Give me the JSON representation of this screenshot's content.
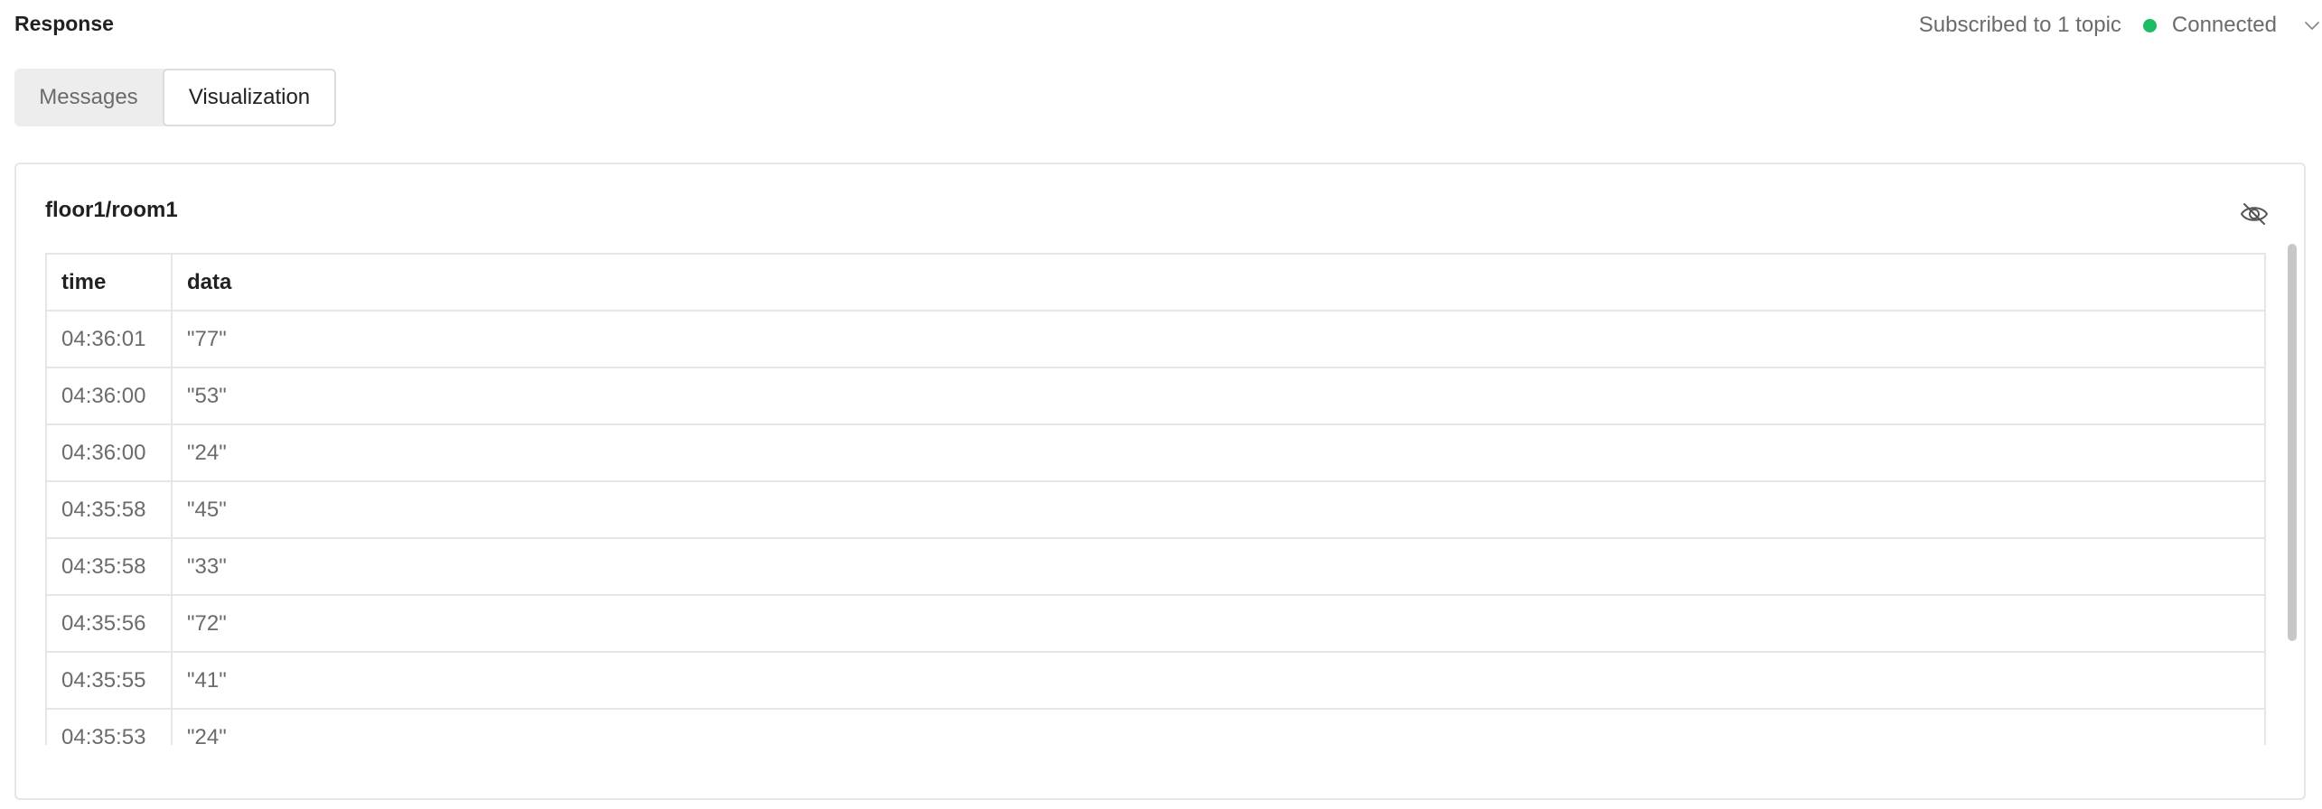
{
  "header": {
    "title": "Response",
    "subscribed_text": "Subscribed to 1 topic",
    "status_text": "Connected",
    "status_color": "#1ebc61"
  },
  "tabs": [
    {
      "label": "Messages",
      "active": false
    },
    {
      "label": "Visualization",
      "active": true
    }
  ],
  "panel": {
    "topic": "floor1/room1",
    "hide_icon": "eye-off-icon",
    "columns": [
      "time",
      "data"
    ],
    "rows": [
      {
        "time": "04:36:01",
        "data": "\"77\""
      },
      {
        "time": "04:36:00",
        "data": "\"53\""
      },
      {
        "time": "04:36:00",
        "data": "\"24\""
      },
      {
        "time": "04:35:58",
        "data": "\"45\""
      },
      {
        "time": "04:35:58",
        "data": "\"33\""
      },
      {
        "time": "04:35:56",
        "data": "\"72\""
      },
      {
        "time": "04:35:55",
        "data": "\"41\""
      },
      {
        "time": "04:35:53",
        "data": "\"24\""
      }
    ]
  }
}
